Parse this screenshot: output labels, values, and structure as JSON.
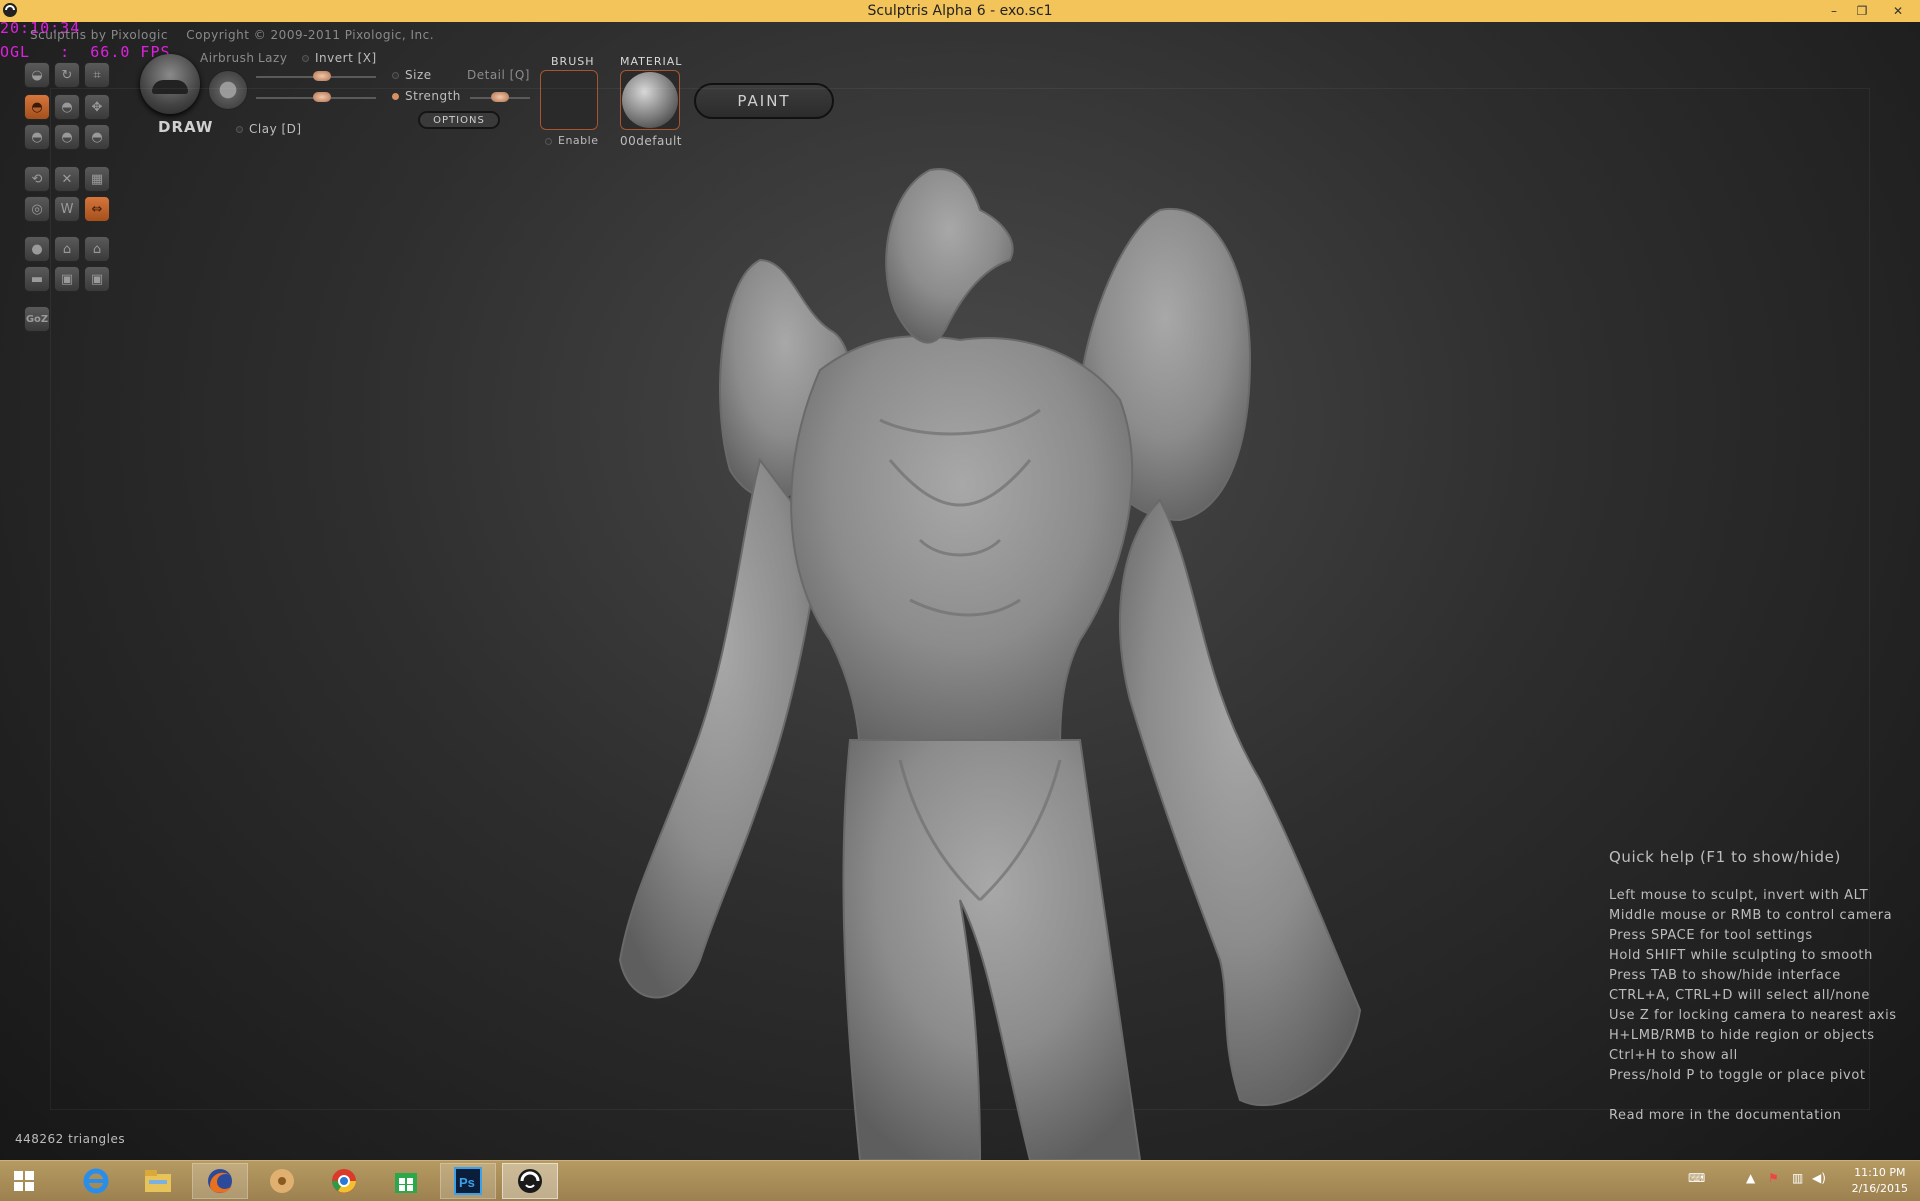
{
  "window": {
    "title": "Sculptris Alpha 6 - exo.sc1",
    "minimize": "–",
    "restore": "❐",
    "close": "✕"
  },
  "overlay": {
    "time": "20:10:34",
    "fps": "OGL   :  66.0 FPS"
  },
  "header": {
    "product": "Sculptris by Pixologic",
    "copyright": "Copyright © 2009-2011 Pixologic, Inc."
  },
  "tool": {
    "name": "DRAW",
    "airbrush": "Airbrush",
    "lazy": "Lazy",
    "invert": "Invert [X]",
    "clay": "Clay [D]",
    "size": "Size",
    "strength": "Strength",
    "detail": "Detail [Q]",
    "options": "OPTIONS",
    "size_level": 0.55,
    "strength_level": 0.55,
    "detail_level": 0.5
  },
  "brush": {
    "title": "BRUSH",
    "enable": "Enable"
  },
  "material": {
    "title": "MATERIAL",
    "name": "00default"
  },
  "paint_button": "PAINT",
  "palette": {
    "goz": "GoZ"
  },
  "help": {
    "title": "Quick help (F1 to show/hide)",
    "lines": [
      "Left mouse to sculpt, invert with ALT",
      "Middle mouse or RMB to control camera",
      "Press SPACE for tool settings",
      "Hold SHIFT while sculpting to smooth",
      "Press TAB to show/hide interface",
      "CTRL+A, CTRL+D will select all/none",
      "Use Z for locking camera to nearest axis",
      "H+LMB/RMB to hide region or objects",
      "Ctrl+H to show all",
      "Press/hold P to toggle or place pivot"
    ],
    "more": "Read more in the documentation"
  },
  "status": {
    "triangles": "448262 triangles"
  },
  "taskbar": {
    "time": "11:10 PM",
    "date": "2/16/2015",
    "ps_label": "Ps",
    "apps": [
      "start-icon",
      "internet-explorer-icon",
      "file-explorer-icon",
      "firefox-icon",
      "app-disc-icon",
      "chrome-icon",
      "store-icon",
      "photoshop-icon",
      "sculptris-icon"
    ]
  },
  "colors": {
    "accent": "#d6763c",
    "titlebar": "#f2c45a",
    "debug": "#e020e0"
  }
}
